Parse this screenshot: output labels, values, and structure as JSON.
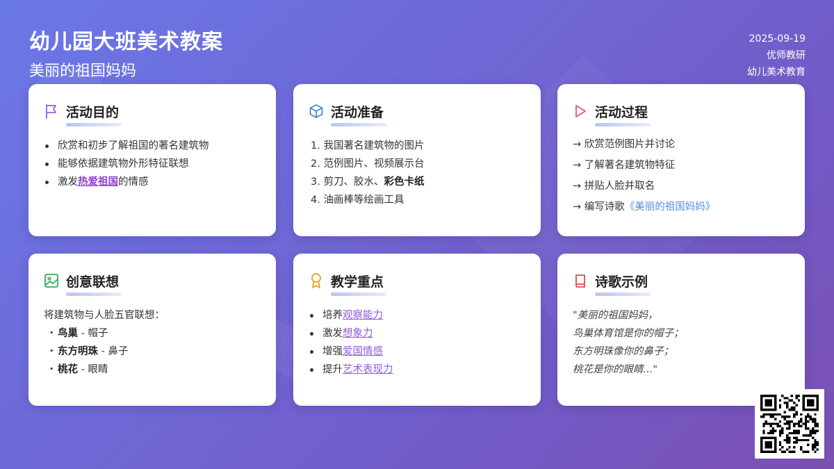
{
  "header": {
    "title": "幼儿园大班美术教案",
    "subtitle": "美丽的祖国妈妈"
  },
  "meta": {
    "date": "2025-09-19",
    "author": "优师教研",
    "org": "幼儿美术教育"
  },
  "cards": {
    "goals": {
      "title": "活动目的",
      "icon": "flag-icon",
      "items": [
        "欣赏和初步了解祖国的著名建筑物",
        "能够依据建筑物外形特征联想"
      ],
      "item3_prefix": "激发",
      "item3_highlight": "热爱祖国",
      "item3_suffix": "的情感"
    },
    "prep": {
      "title": "活动准备",
      "icon": "cube-icon",
      "items": [
        "1. 我国著名建筑物的图片",
        "2. 范例图片、视频展示台"
      ],
      "item3_prefix": "3. 剪刀、胶水、",
      "item3_bold": "彩色卡纸",
      "item4": "4. 油画棒等绘画工具"
    },
    "process": {
      "title": "活动过程",
      "icon": "play-icon",
      "steps": [
        "→ 欣赏范例图片并讨论",
        "→ 了解著名建筑物特征",
        "→ 拼贴人脸并取名"
      ],
      "step4_prefix": "→ 编写诗歌",
      "step4_link": "《美丽的祖国妈妈》"
    },
    "ideas": {
      "title": "创意联想",
      "icon": "image-icon",
      "intro": "将建筑物与人脸五官联想：",
      "bullet": "・",
      "pairs": [
        {
          "a": "鸟巢",
          "b": " - 帽子"
        },
        {
          "a": "东方明珠",
          "b": " - 鼻子"
        },
        {
          "a": "桃花",
          "b": " - 眼睛"
        }
      ]
    },
    "focus": {
      "title": "教学重点",
      "icon": "award-icon",
      "items": [
        {
          "p": "培养",
          "h": "观察能力"
        },
        {
          "p": "激发",
          "h": "想象力"
        },
        {
          "p": "增强",
          "h": "爱国情感"
        },
        {
          "p": "提升",
          "h": "艺术表现力"
        }
      ]
    },
    "poem": {
      "title": "诗歌示例",
      "icon": "book-icon",
      "lines": [
        "\"美丽的祖国妈妈，",
        "鸟巢体育馆是你的帽子；",
        "东方明珠像你的鼻子；",
        "桃花是你的眼睛...\""
      ]
    }
  },
  "colors": {
    "bg_start": "#6a78e6",
    "bg_end": "#7a4fb0",
    "accent_purple": "#8e5bd9",
    "accent_blue": "#4f8fe0"
  }
}
